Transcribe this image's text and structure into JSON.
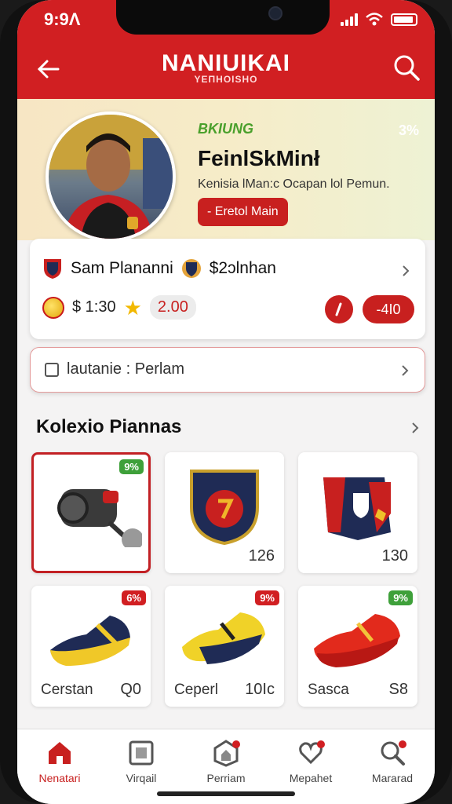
{
  "status_bar": {
    "time": "9:9Λ"
  },
  "app_bar": {
    "title": "NANIUIKAI",
    "subtitle": "YEΠHOISHO"
  },
  "hero": {
    "badge": "BKIUNG",
    "badge_pct": "3%",
    "name": "FeinlSkMinł",
    "description": "Kenisia lMan:c Ocapan lol Pemun.",
    "button": "- Eretol Main"
  },
  "card_stats": {
    "club_name": "Sam Plananni",
    "value": "$2ɔlnhan",
    "coins": "$ 1:30",
    "rating": "2.00",
    "pill": "-4I0"
  },
  "search_card": {
    "label": "lautanie : Perlam"
  },
  "section": {
    "title": "Kolexio Piannas"
  },
  "tiles": [
    {
      "tag": "9%",
      "tag_color": "green",
      "num": "",
      "name": ""
    },
    {
      "tag": "",
      "tag_color": "",
      "num": "126",
      "name": ""
    },
    {
      "tag": "",
      "tag_color": "",
      "num": "130",
      "name": ""
    },
    {
      "tag": "6%",
      "tag_color": "red",
      "num": "Q0",
      "name": "Cerstan"
    },
    {
      "tag": "9%",
      "tag_color": "red",
      "num": "10Ic",
      "name": "Ceperl"
    },
    {
      "tag": "9%",
      "tag_color": "green",
      "num": "S8",
      "name": "Sasca"
    }
  ],
  "nav": [
    {
      "label": "Nenatari"
    },
    {
      "label": "Virqail"
    },
    {
      "label": "Perriam"
    },
    {
      "label": "Mepahet"
    },
    {
      "label": "Mararad"
    }
  ],
  "colors": {
    "accent": "#d11f22",
    "hero_bg": "#f6ecc8",
    "badge_green": "#3ea03a"
  }
}
